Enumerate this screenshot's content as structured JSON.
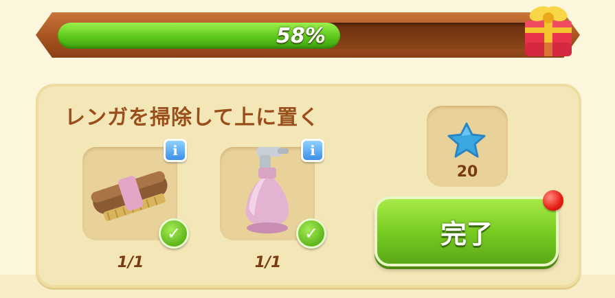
{
  "progress": {
    "percent_label": "58%",
    "value": 0.58,
    "fill_color": "#5cc81b"
  },
  "reward_chest": {
    "icon": "gift-box-icon"
  },
  "task": {
    "title": "レンガを掃除して上に置く",
    "items": [
      {
        "icon": "brush-icon",
        "count": "1/1",
        "info_icon": "info-icon",
        "status_icon": "check-icon"
      },
      {
        "icon": "spray-bottle-icon",
        "count": "1/1",
        "info_icon": "info-icon",
        "status_icon": "check-icon"
      }
    ],
    "reward": {
      "icon": "blue-star-icon",
      "amount": "20"
    },
    "complete_button_label": "完了"
  },
  "colors": {
    "panel_bg": "#f4e7b7",
    "title_color": "#9a4e1c",
    "button_green": "#79cc22",
    "notification_red": "#e51d12"
  }
}
